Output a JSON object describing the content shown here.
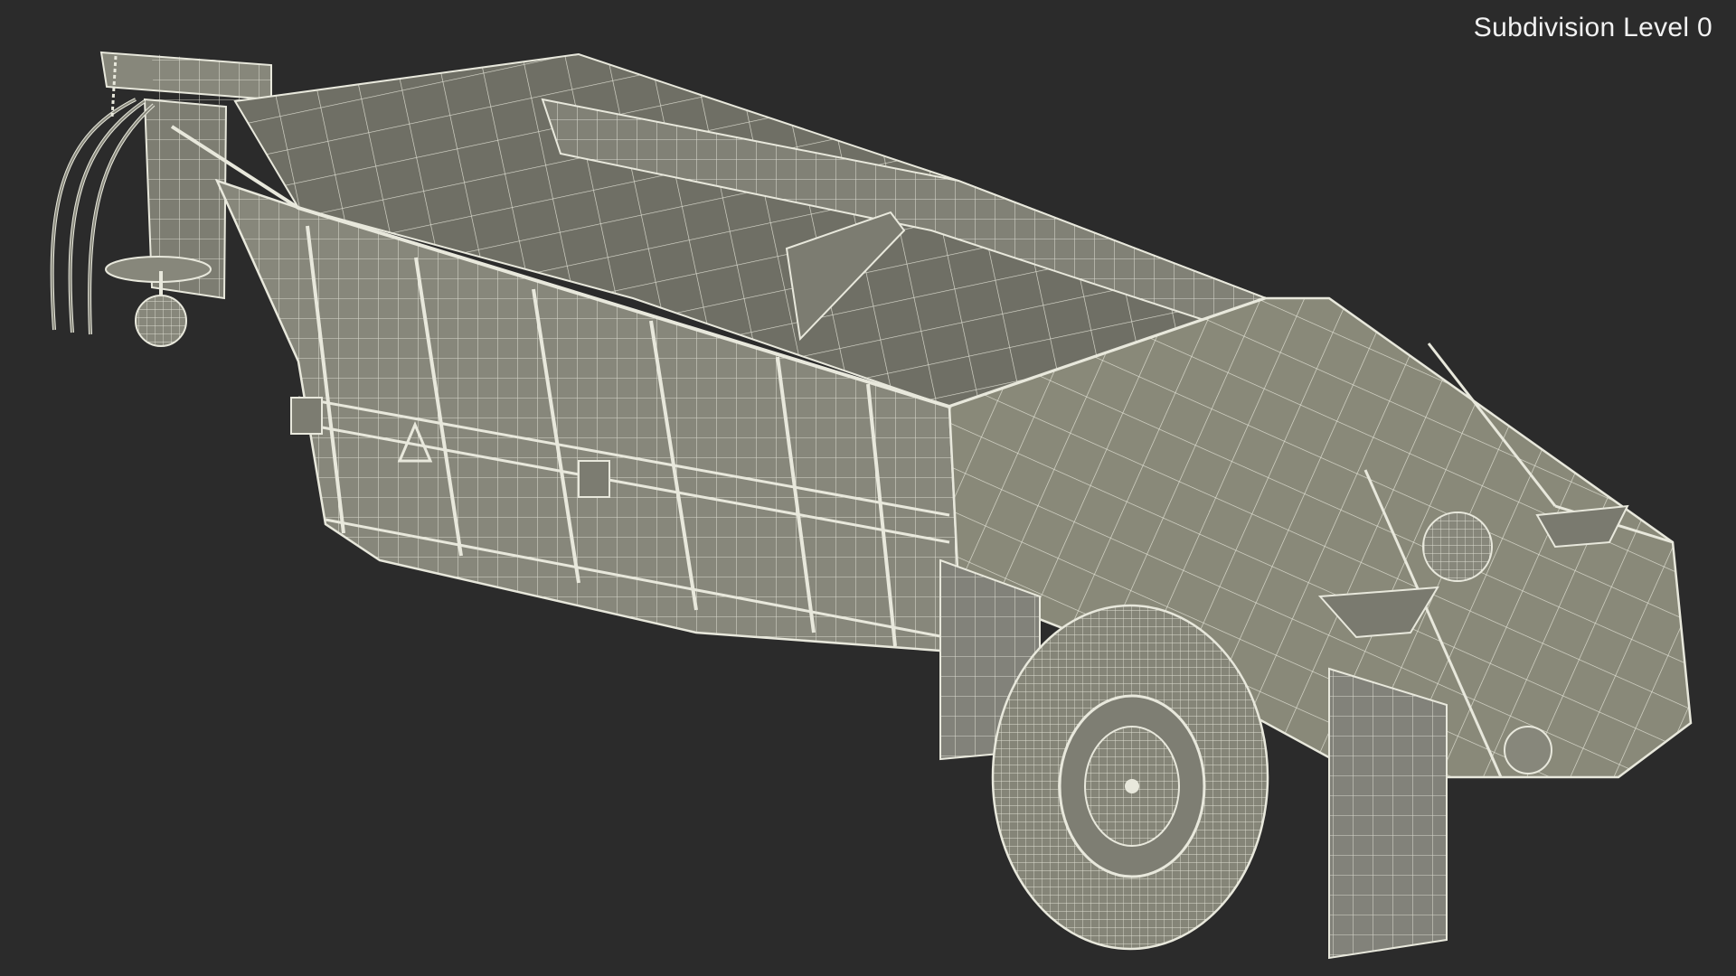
{
  "viewport": {
    "background_color": "#2b2b2b",
    "label": "Subdivision Level 0",
    "model": {
      "surface_color": "#87877b",
      "surface_dark_color": "#6c6c62",
      "surface_light_color": "#97978a",
      "wire_color": "#e8e8dc",
      "icon": "wireframe-trailer-model"
    }
  }
}
